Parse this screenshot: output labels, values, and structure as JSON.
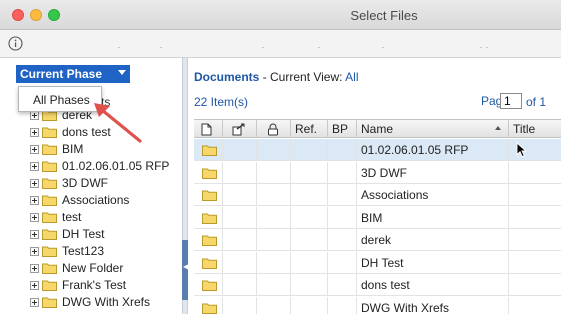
{
  "window": {
    "title": "Select Files"
  },
  "left_pane": {
    "phase_header": "Current Phase",
    "dropdown_option": "All Phases",
    "obscured_text": "ts",
    "folders": [
      "derek",
      "dons test",
      "BIM",
      "01.02.06.01.05 RFP",
      "3D DWF",
      "Associations",
      "test",
      "DH Test",
      "Test123",
      "New Folder",
      "Frank's Test",
      "DWG With Xrefs"
    ]
  },
  "documents": {
    "title": "Documents",
    "view_prefix": " - Current View: ",
    "view_name": "All",
    "item_count": "22 Item(s)",
    "page_label": "Page",
    "page_value": "1",
    "page_total": "of 1",
    "columns": [
      "",
      "",
      "",
      "Ref.",
      "BP",
      "Name",
      "Title"
    ],
    "rows": [
      "01.02.06.01.05 RFP",
      "3D DWF",
      "Associations",
      "BIM",
      "derek",
      "DH Test",
      "dons test",
      "DWG With Xrefs"
    ]
  },
  "colors": {
    "accent": "#1f63c4",
    "link": "#1f57a6",
    "folder": "#f5d76a",
    "selected_row": "#dbe8f6"
  },
  "icons": [
    "info-icon",
    "folder-icon",
    "document-icon",
    "checkout-icon",
    "lock-icon",
    "expand-icon",
    "sort-arrow-icon",
    "mouse-cursor-icon"
  ]
}
